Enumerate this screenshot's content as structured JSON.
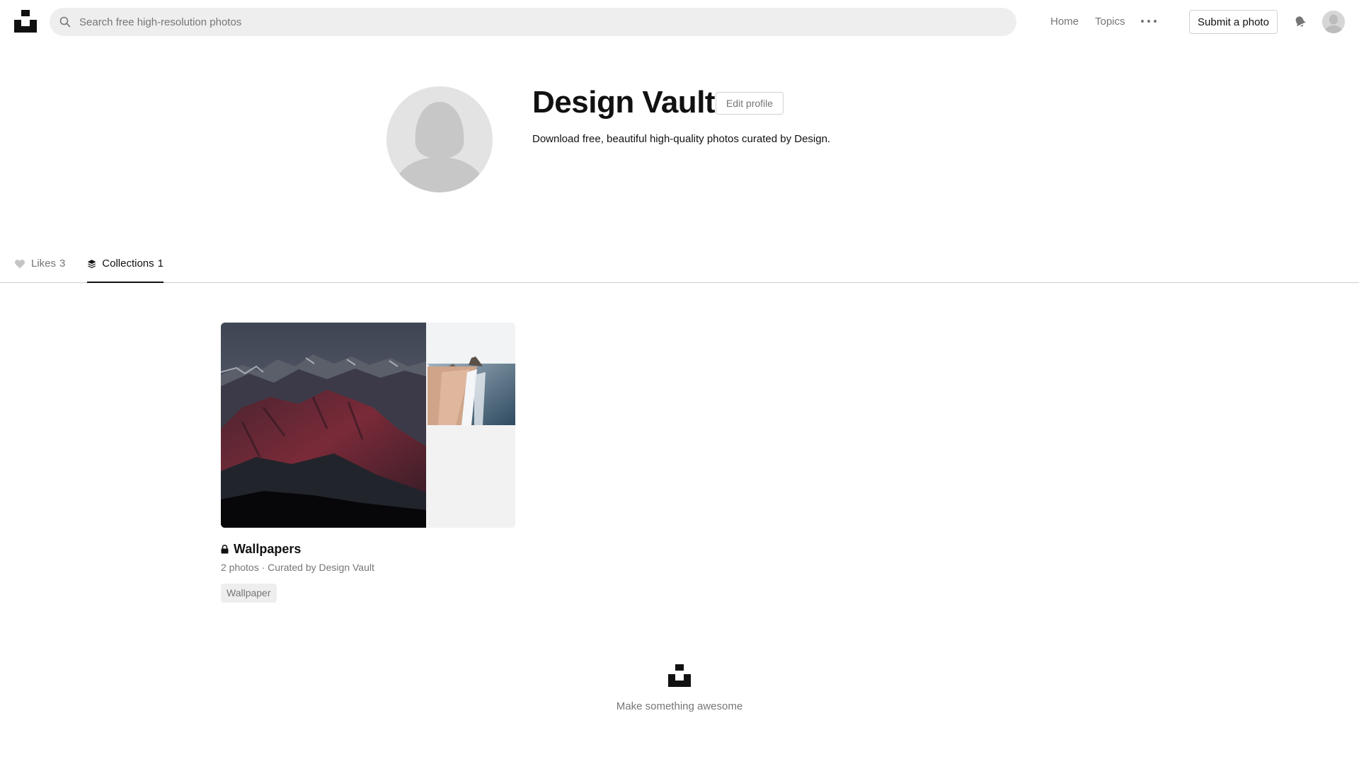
{
  "header": {
    "search_placeholder": "Search free high-resolution photos",
    "nav": {
      "home": "Home",
      "topics": "Topics"
    },
    "submit_label": "Submit a photo"
  },
  "profile": {
    "name": "Design Vault",
    "edit_label": "Edit profile",
    "bio": "Download free, beautiful high-quality photos curated by Design."
  },
  "tabs": [
    {
      "label": "Likes",
      "count": "3",
      "icon": "heart-icon",
      "active": false
    },
    {
      "label": "Collections",
      "count": "1",
      "icon": "layers-icon",
      "active": true
    }
  ],
  "collections": [
    {
      "title": "Wallpapers",
      "private": true,
      "meta": "2 photos · Curated by Design Vault",
      "tags": [
        "Wallpaper"
      ]
    }
  ],
  "footer": {
    "tagline": "Make something awesome"
  },
  "colors": {
    "primary_text": "#111111",
    "muted_text": "#767676",
    "search_bg": "#eeeeee",
    "border": "#d1d1d1"
  }
}
